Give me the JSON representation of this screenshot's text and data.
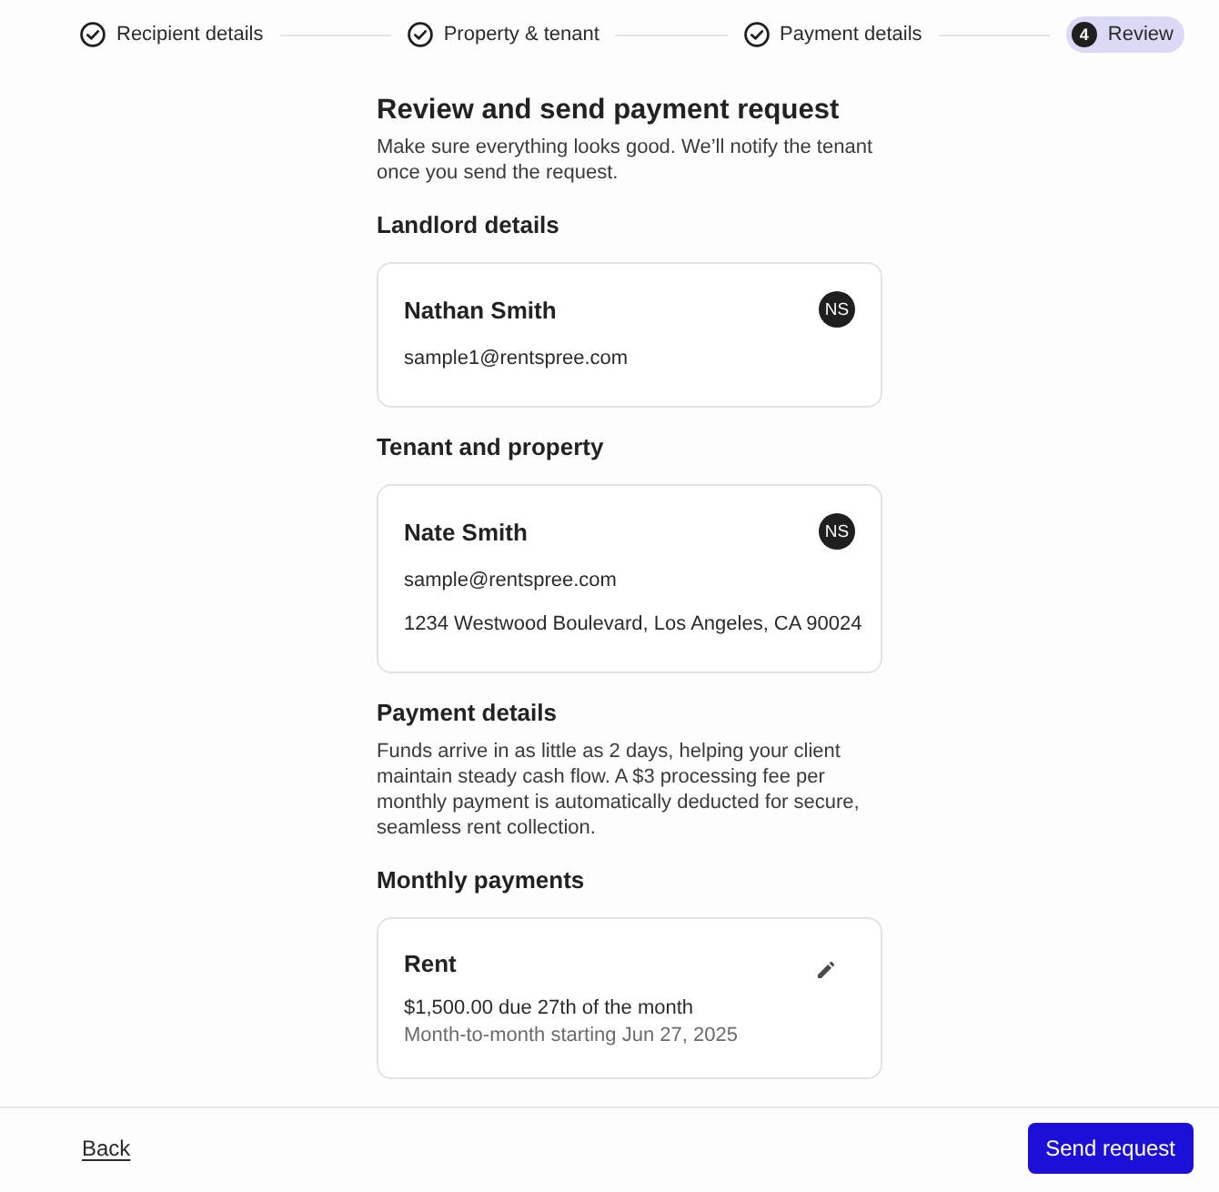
{
  "stepper": {
    "steps": [
      {
        "label": "Recipient details",
        "completed": true,
        "selected": false
      },
      {
        "label": "Property & tenant",
        "completed": true,
        "selected": false
      },
      {
        "label": "Payment details",
        "completed": true,
        "selected": false
      },
      {
        "number": "4",
        "label": "Review",
        "completed": false,
        "selected": true
      }
    ]
  },
  "page": {
    "title": "Review and send payment request",
    "subtitle": "Make sure everything looks good. We’ll notify the tenant once you send the request.",
    "sections": [
      {
        "kind": "contact",
        "heading": "Landlord details",
        "name": "Nathan Smith",
        "initials": "NS",
        "lines": [
          "sample1@rentspree.com"
        ]
      },
      {
        "kind": "contact",
        "heading": "Tenant and property",
        "name": "Nate Smith",
        "initials": "NS",
        "lines": [
          "sample@rentspree.com",
          "1234 Westwood Boulevard, Los Angeles, CA 90024"
        ]
      },
      {
        "kind": "note",
        "heading": "Payment details",
        "text": "Funds arrive in as little as 2 days, helping your client maintain steady cash flow. A $3 processing fee per monthly payment is automatically deducted for secure, seamless rent collection."
      },
      {
        "kind": "payments",
        "heading": "Monthly payments",
        "payments": [
          {
            "title": "Rent",
            "amount": "$1,500.00 due 27th of the month",
            "term": "Month-to-month starting Jun 27, 2025"
          }
        ]
      }
    ]
  },
  "footer": {
    "back": "Back",
    "submit": "Send request"
  }
}
